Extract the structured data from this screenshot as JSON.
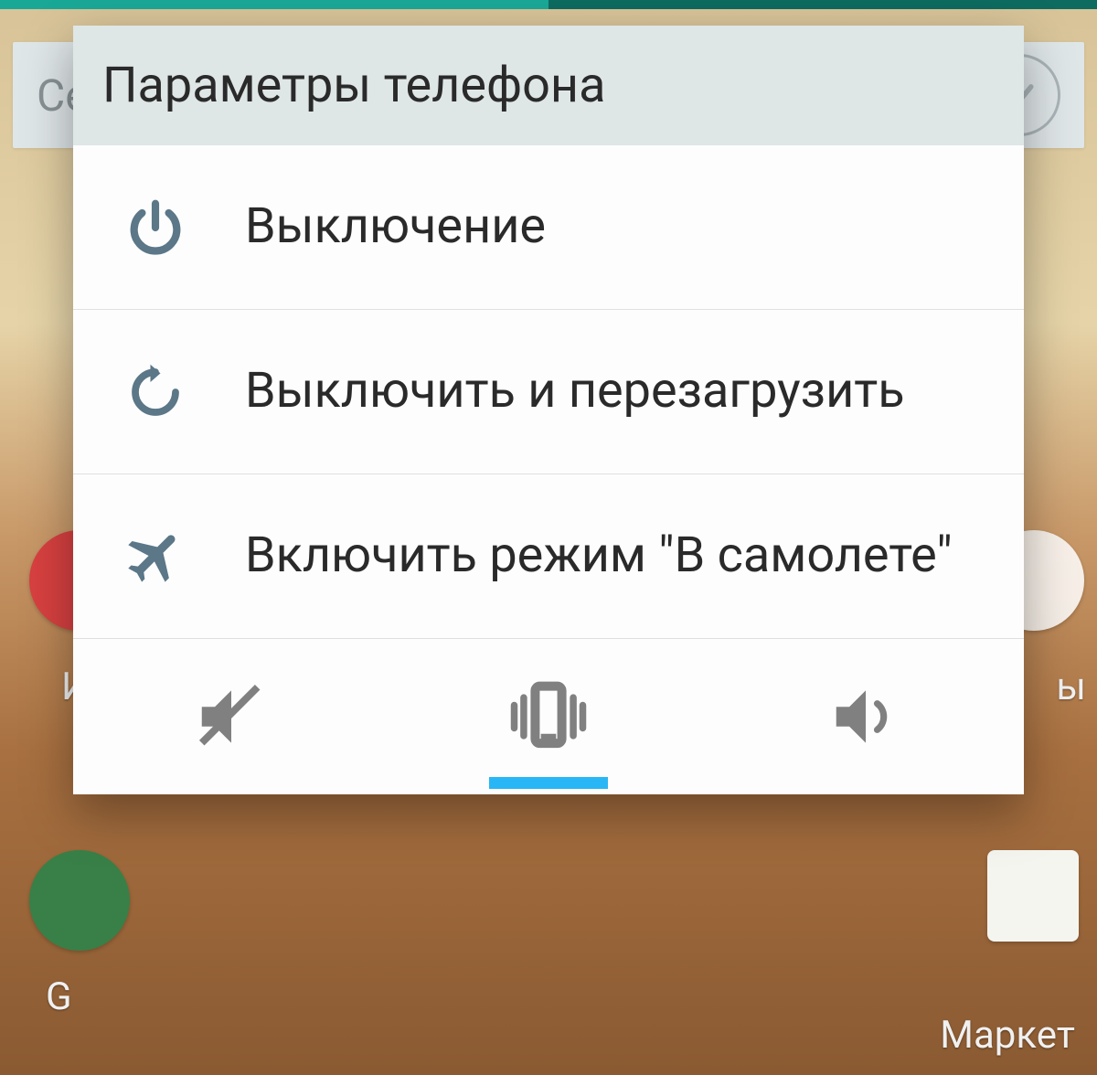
{
  "background": {
    "search_hint": "Се",
    "labels": {
      "left1": "И",
      "right1": "ы",
      "left2": "G",
      "right2": "Маркет"
    }
  },
  "dialog": {
    "title": "Параметры телефона",
    "items": [
      {
        "label": "Выключение"
      },
      {
        "label": "Выключить и перезагрузить"
      },
      {
        "label": "Включить режим \"В самолете\""
      }
    ],
    "sound_modes": {
      "active_index": 1
    }
  },
  "colors": {
    "icon_primary": "#5b7788",
    "icon_muted": "#808080",
    "accent": "#29b6f6"
  }
}
